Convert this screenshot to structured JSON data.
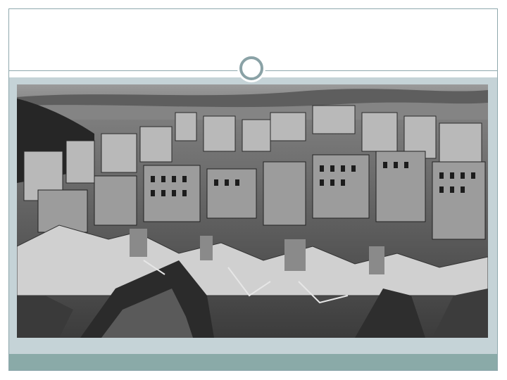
{
  "slide": {
    "title": "",
    "image": {
      "icon": "ruined-city-photo",
      "description_visible": false
    }
  },
  "colors": {
    "frame_border": "#8fa8ad",
    "body_panel": "#c5d3d7",
    "bottom_band": "#8aaaa8",
    "ornament": "#8aa2a6"
  }
}
